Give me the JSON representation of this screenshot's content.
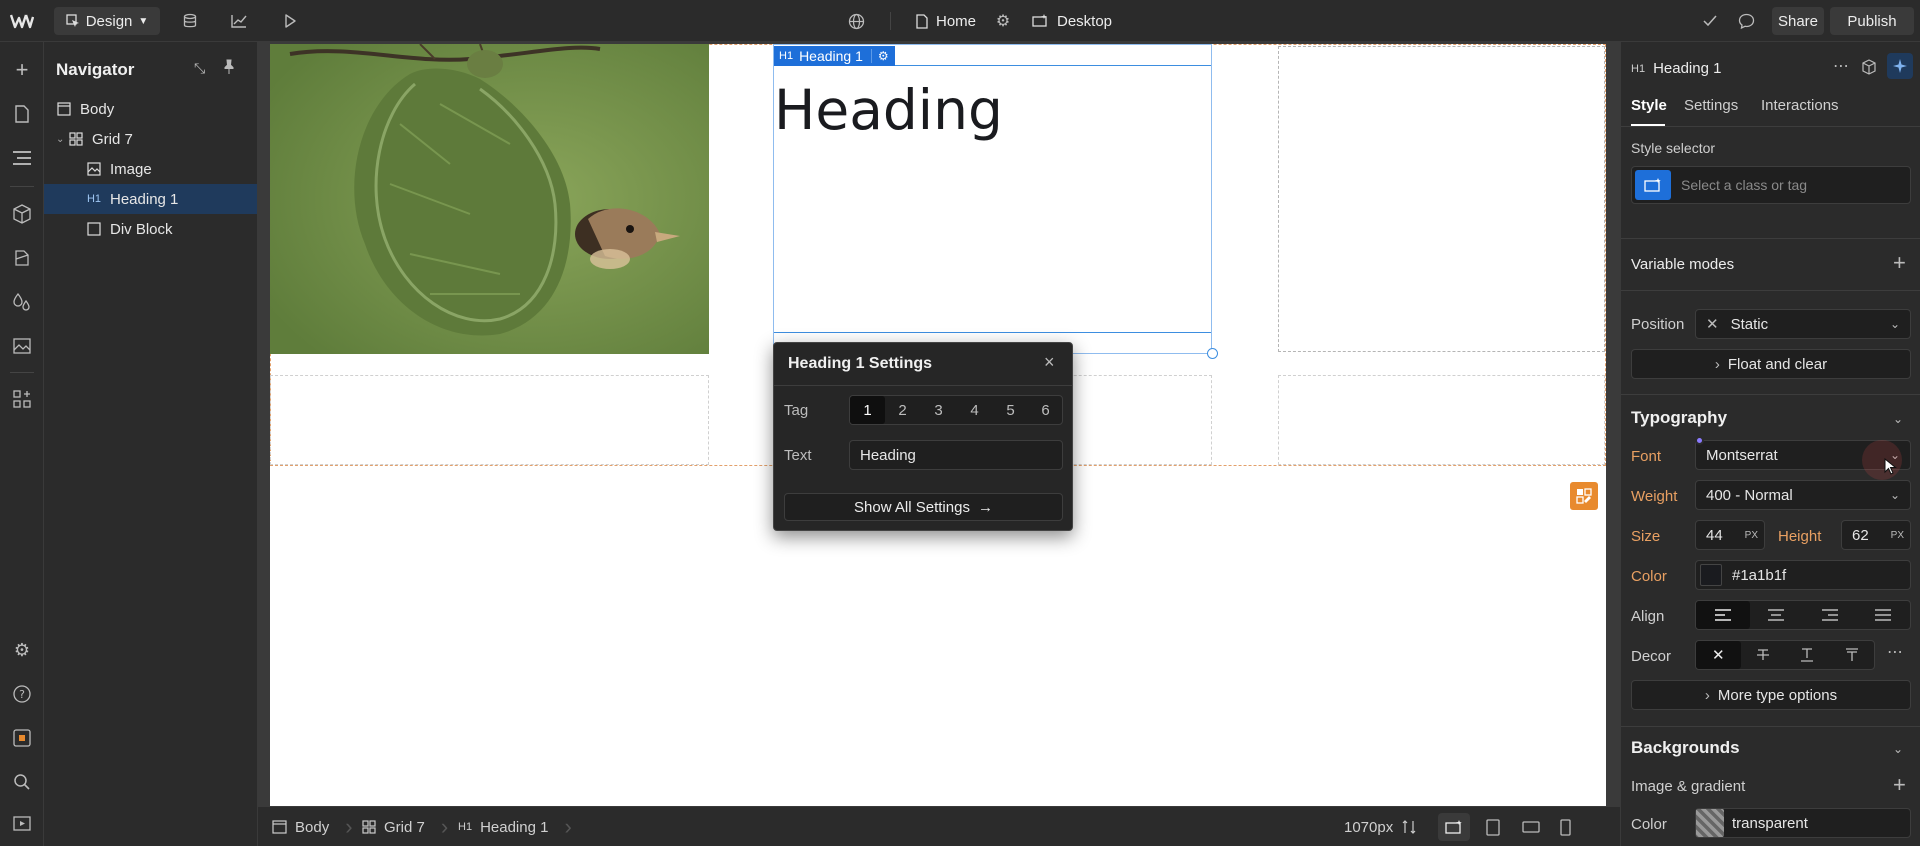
{
  "topbar": {
    "mode_label": "Design",
    "page_label": "Home",
    "breakpoint_label": "Desktop",
    "share_label": "Share",
    "publish_label": "Publish"
  },
  "navigator": {
    "title": "Navigator",
    "items": [
      {
        "label": "Body",
        "icon": "body-icon"
      },
      {
        "label": "Grid 7",
        "icon": "grid-icon"
      },
      {
        "label": "Image",
        "icon": "image-icon"
      },
      {
        "label": "Heading 1",
        "icon": "h1-icon",
        "badge": "H1"
      },
      {
        "label": "Div Block",
        "icon": "div-icon"
      }
    ]
  },
  "canvas": {
    "element_label": "Heading 1",
    "element_badge": "H1",
    "heading_text": "Heading"
  },
  "popup": {
    "title": "Heading 1 Settings",
    "tag_label": "Tag",
    "tags": [
      "1",
      "2",
      "3",
      "4",
      "5",
      "6"
    ],
    "selected_tag": "1",
    "text_label": "Text",
    "text_value": "Heading",
    "show_all_label": "Show All Settings"
  },
  "bottombar": {
    "crumbs": [
      "Body",
      "Grid 7",
      "Heading 1"
    ],
    "crumb_badge": "H1",
    "width_label": "1070px"
  },
  "rpanel": {
    "element_title": "Heading 1",
    "element_badge": "H1",
    "tabs": [
      "Style",
      "Settings",
      "Interactions"
    ],
    "style_selector_label": "Style selector",
    "style_selector_placeholder": "Select a class or tag",
    "variable_modes_label": "Variable modes",
    "position_label": "Position",
    "position_value": "Static",
    "float_clear_label": "Float and clear",
    "typography_title": "Typography",
    "font_label": "Font",
    "font_value": "Montserrat",
    "weight_label": "Weight",
    "weight_value": "400 - Normal",
    "size_label": "Size",
    "size_value": "44",
    "size_unit": "PX",
    "height_label": "Height",
    "height_value": "62",
    "height_unit": "PX",
    "color_label": "Color",
    "color_value": "#1a1b1f",
    "align_label": "Align",
    "decor_label": "Decor",
    "more_type_label": "More type options",
    "backgrounds_title": "Backgrounds",
    "image_gradient_label": "Image & gradient",
    "bg_color_label": "Color",
    "bg_color_value": "transparent"
  },
  "colors": {
    "accent": "#1e6fd9",
    "selection": "#3d8ee0",
    "orange": "#e9a062",
    "heading_color": "#1a1b1f"
  }
}
